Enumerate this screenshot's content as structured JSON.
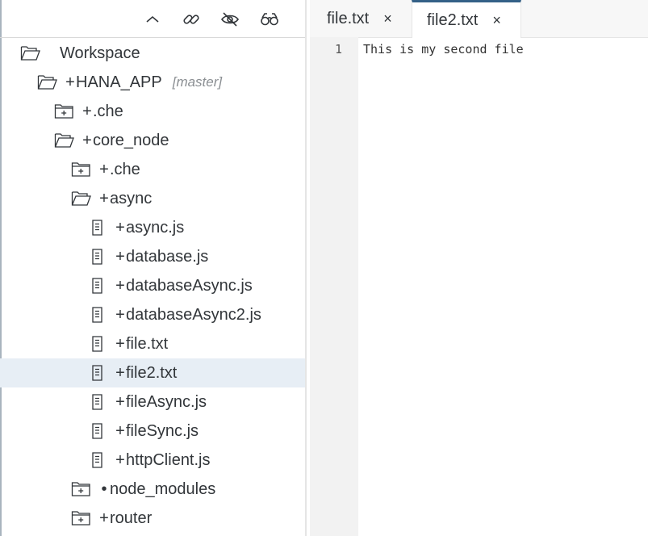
{
  "toolbar": {
    "icons": [
      "collapse-icon",
      "link-icon",
      "hide-icon",
      "search-icon"
    ]
  },
  "tree": {
    "workspace": {
      "label": "Workspace"
    },
    "hana_app": {
      "marker": "+",
      "label": "HANA_APP",
      "branch": "[master]"
    },
    "items": [
      {
        "marker": "+",
        "label": ".che"
      },
      {
        "marker": "+",
        "label": "core_node"
      },
      {
        "marker": "+",
        "label": ".che"
      },
      {
        "marker": "+",
        "label": "async"
      },
      {
        "marker": "+",
        "label": "async.js"
      },
      {
        "marker": "+",
        "label": "database.js"
      },
      {
        "marker": "+",
        "label": "databaseAsync.js"
      },
      {
        "marker": "+",
        "label": "databaseAsync2.js"
      },
      {
        "marker": "+",
        "label": "file.txt"
      },
      {
        "marker": "+",
        "label": "file2.txt"
      },
      {
        "marker": "+",
        "label": "fileAsync.js"
      },
      {
        "marker": "+",
        "label": "fileSync.js"
      },
      {
        "marker": "+",
        "label": "httpClient.js"
      },
      {
        "marker": "•",
        "label": "node_modules"
      },
      {
        "marker": "+",
        "label": "router"
      }
    ]
  },
  "editor": {
    "tabs": [
      {
        "label": "file.txt",
        "close": "×"
      },
      {
        "label": "file2.txt",
        "close": "×"
      }
    ],
    "line_number": "1",
    "line_text": "This is my second file"
  },
  "colors": {
    "accent": "#346187",
    "selection": "#e7eef5"
  }
}
